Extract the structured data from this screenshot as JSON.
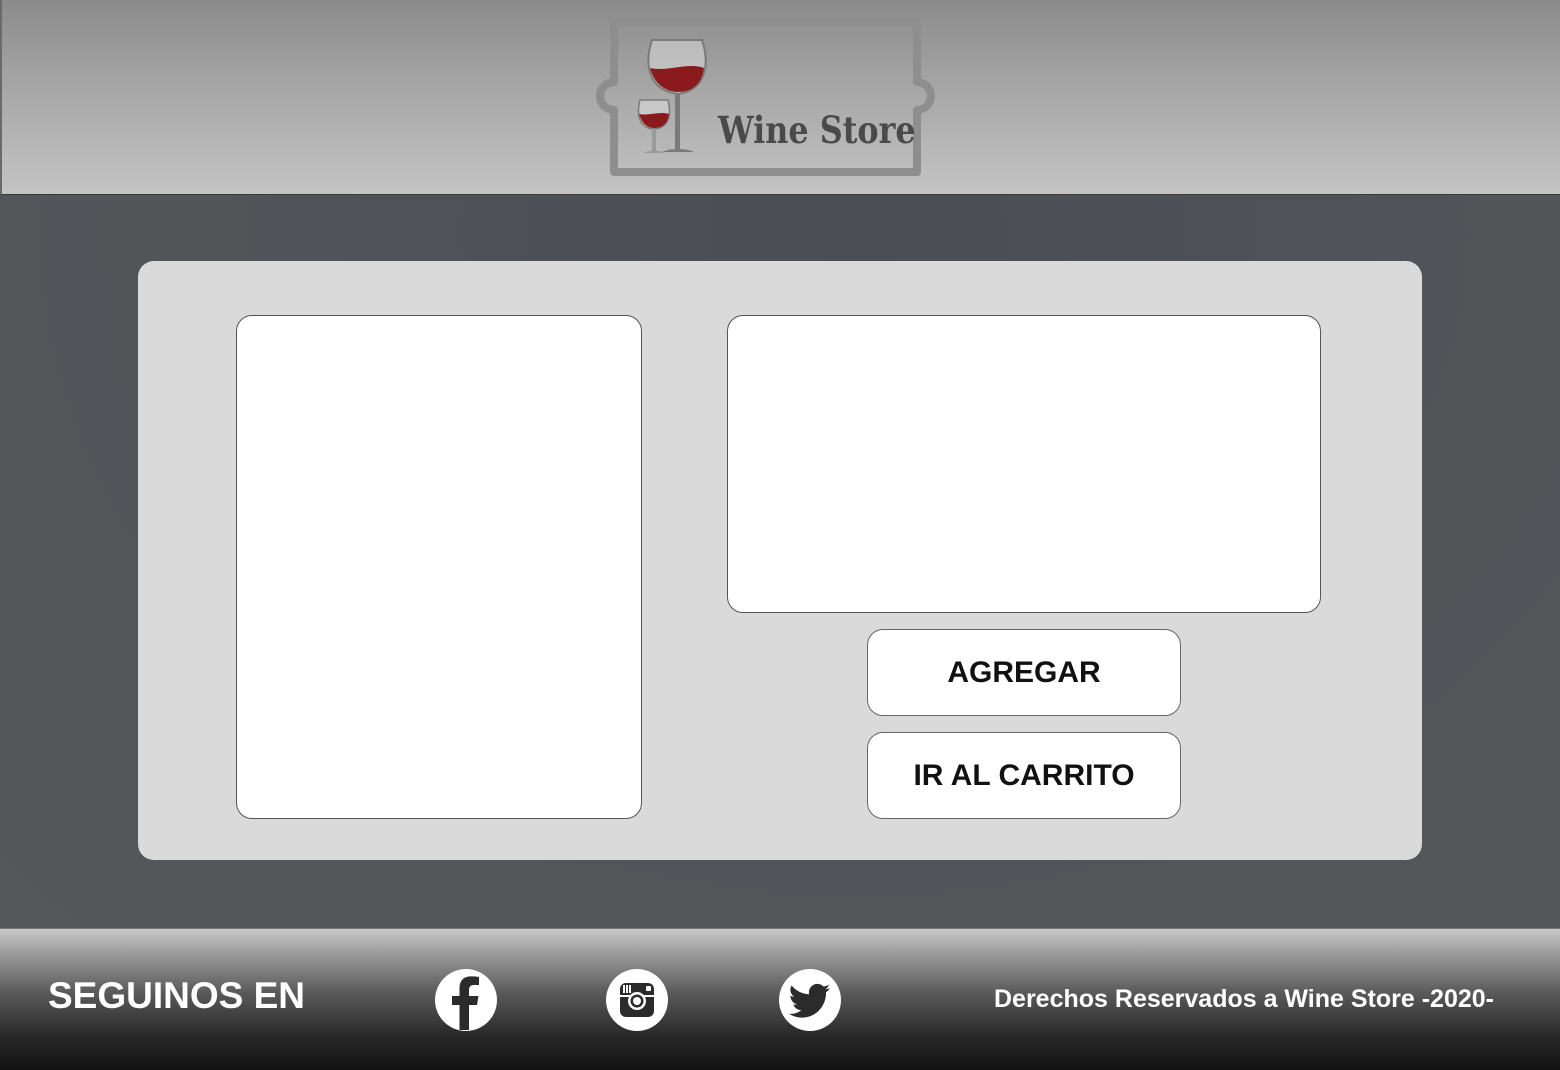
{
  "header": {
    "logo_text": "Wine Store"
  },
  "product": {
    "add_button": "AGREGAR",
    "cart_button": "IR AL CARRITO"
  },
  "footer": {
    "follow_label": "SEGUINOS EN",
    "social": [
      "facebook-icon",
      "instagram-icon",
      "twitter-icon"
    ],
    "rights": "Derechos Reservados a Wine Store -2020-"
  },
  "colors": {
    "wine": "#8b1a1f",
    "background": "#4f5155",
    "panel": "#dadada"
  }
}
